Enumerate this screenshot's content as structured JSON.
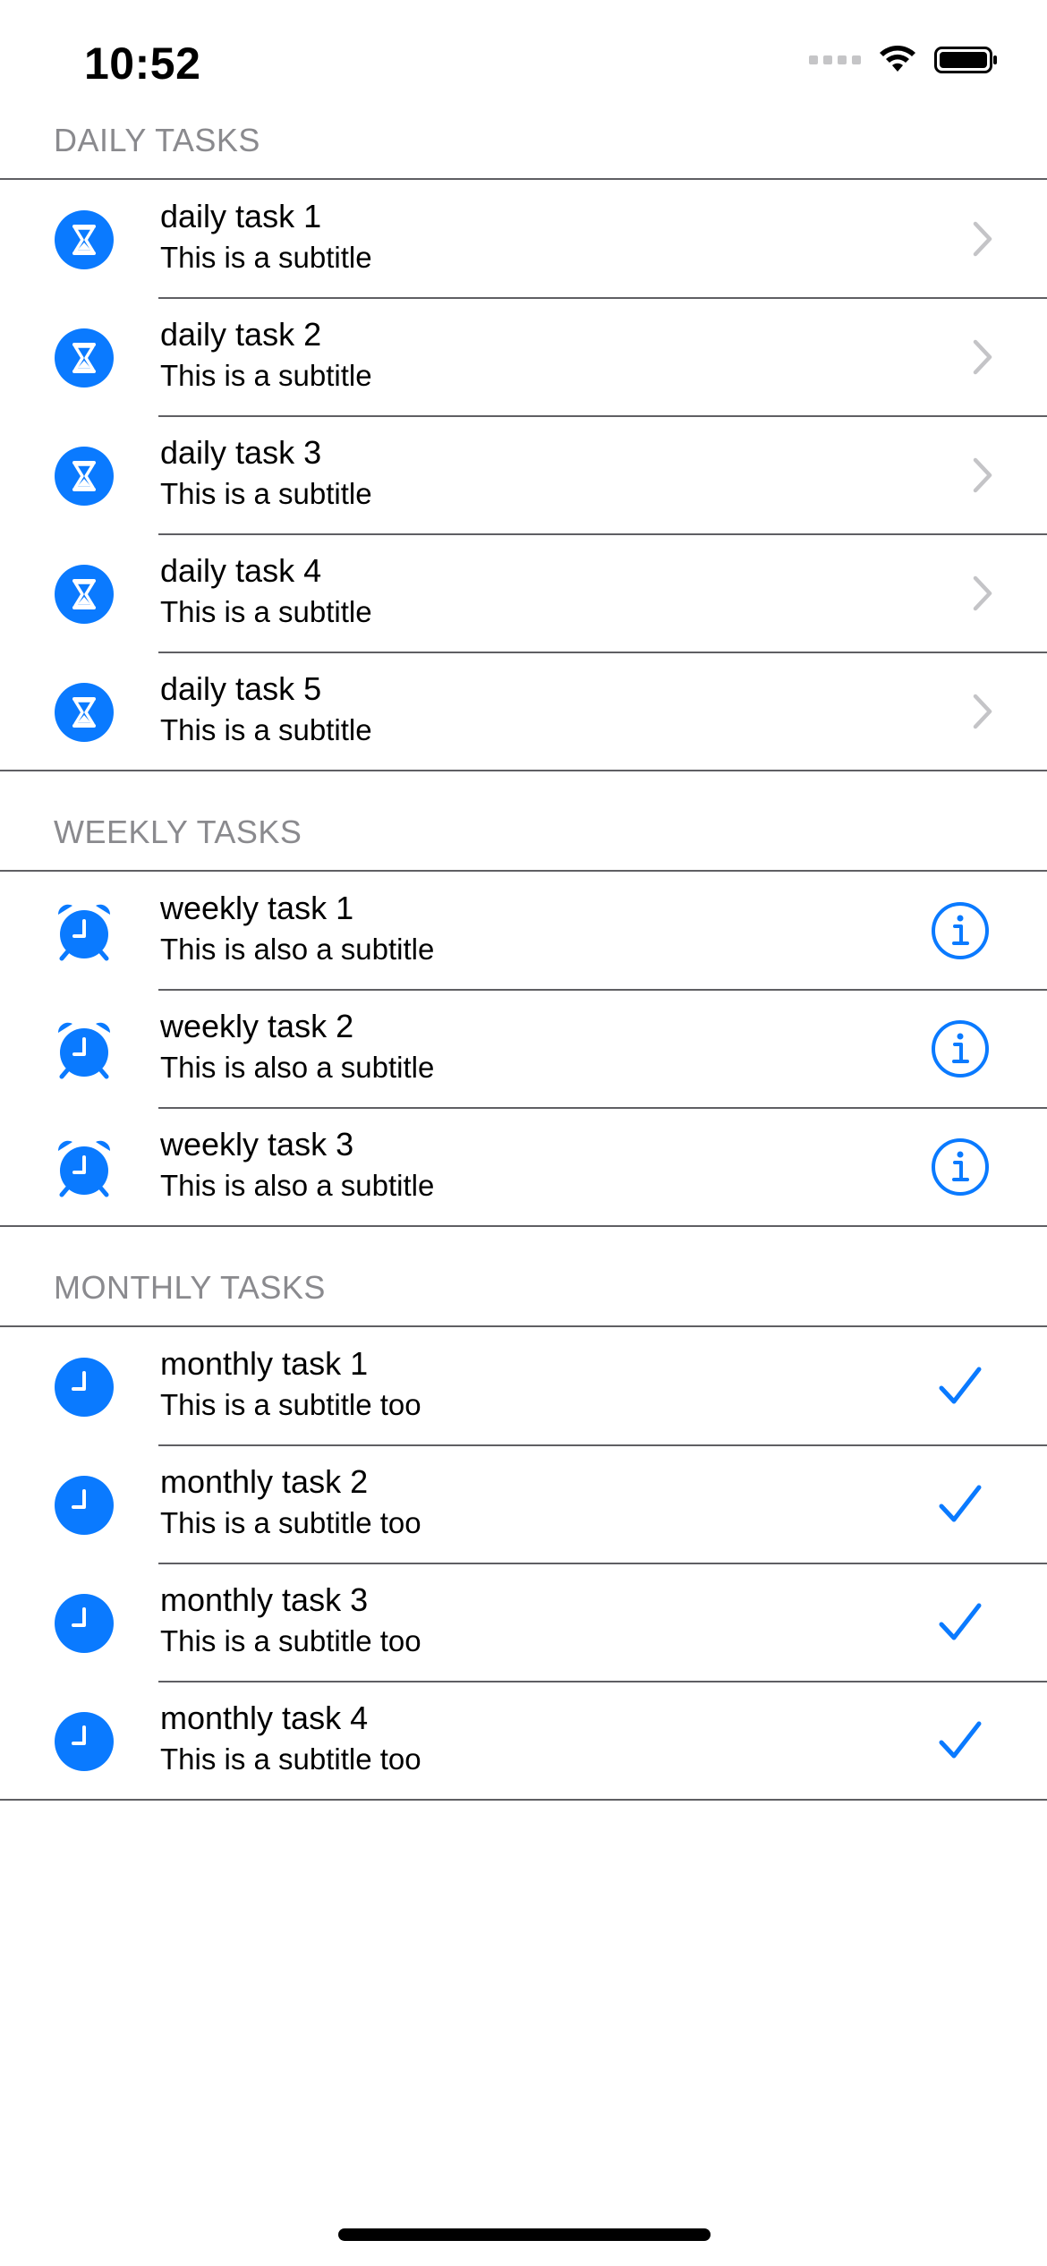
{
  "status_bar": {
    "time": "10:52",
    "signal_icon": "cellular-signal-icon",
    "wifi_icon": "wifi-icon",
    "battery_icon": "battery-full-icon"
  },
  "sections": {
    "daily": {
      "header": "DAILY TASKS",
      "icon": "hourglass-circle-icon",
      "accessory": "chevron-right-icon",
      "items": [
        {
          "title": "daily task 1",
          "subtitle": "This is a subtitle"
        },
        {
          "title": "daily task 2",
          "subtitle": "This is a subtitle"
        },
        {
          "title": "daily task 3",
          "subtitle": "This is a subtitle"
        },
        {
          "title": "daily task 4",
          "subtitle": "This is a subtitle"
        },
        {
          "title": "daily task 5",
          "subtitle": "This is a subtitle"
        }
      ]
    },
    "weekly": {
      "header": "WEEKLY TASKS",
      "icon": "alarm-clock-icon",
      "accessory": "info-circle-icon",
      "items": [
        {
          "title": "weekly task 1",
          "subtitle": "This is also a subtitle"
        },
        {
          "title": "weekly task 2",
          "subtitle": "This is also a subtitle"
        },
        {
          "title": "weekly task 3",
          "subtitle": "This is also a subtitle"
        }
      ]
    },
    "monthly": {
      "header": "MONTHLY TASKS",
      "icon": "clock-circle-icon",
      "accessory": "checkmark-icon",
      "items": [
        {
          "title": "monthly task 1",
          "subtitle": "This is a subtitle too"
        },
        {
          "title": "monthly task 2",
          "subtitle": "This is a subtitle too"
        },
        {
          "title": "monthly task 3",
          "subtitle": "This is a subtitle too"
        },
        {
          "title": "monthly task 4",
          "subtitle": "This is a subtitle too"
        }
      ]
    }
  },
  "colors": {
    "accent": "#0A7AFF",
    "chevron": "#C4C4C7",
    "header_text": "#8A8A8E",
    "separator": "#5F5F63"
  }
}
